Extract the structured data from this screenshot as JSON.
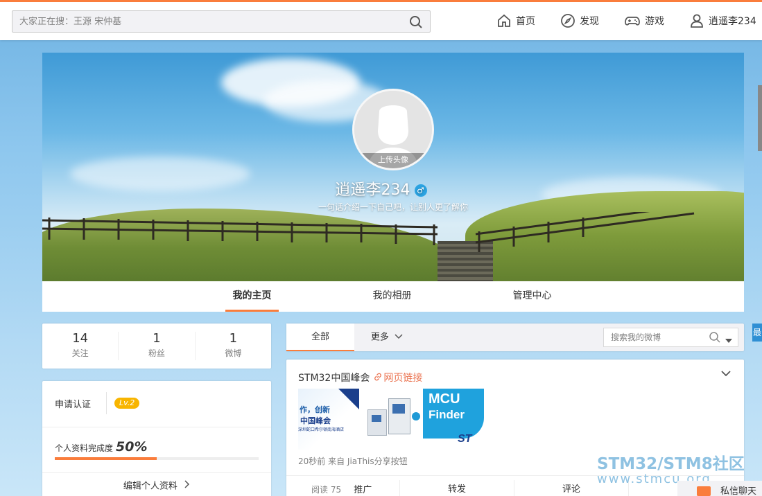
{
  "topbar": {
    "search_placeholder": "大家正在搜：王源 宋仲基",
    "nav": [
      {
        "label": "首页"
      },
      {
        "label": "发现"
      },
      {
        "label": "游戏"
      },
      {
        "label": "逍遥李234"
      }
    ]
  },
  "cover": {
    "upload_avatar": "上传头像",
    "username": "逍遥李234",
    "gender": "♂",
    "bio": "一句话介绍一下自己吧，让别人更了解你"
  },
  "tabs": [
    {
      "label": "我的主页",
      "active": true
    },
    {
      "label": "我的相册",
      "active": false
    },
    {
      "label": "管理中心",
      "active": false
    }
  ],
  "counts": [
    {
      "num": "14",
      "label": "关注"
    },
    {
      "num": "1",
      "label": "粉丝"
    },
    {
      "num": "1",
      "label": "微博"
    }
  ],
  "profile": {
    "verify_label": "申请认证",
    "level": "Lv.2",
    "complete_label": "个人资料完成度",
    "complete_value": "50%",
    "complete_fraction": 0.5,
    "edit_label": "编辑个人资料"
  },
  "feed": {
    "tab_all": "全部",
    "tab_more": "更多",
    "search_placeholder": "搜索我的微博"
  },
  "post": {
    "author": "STM32中国峰会",
    "link_label": "网页链接",
    "thumb1_line1": "作，创新",
    "thumb1_line2": "中国峰会",
    "thumb1_line3": "深圳蛇口希尔顿南海酒店",
    "thumb3_line1": "MCU",
    "thumb3_line2": "Finder",
    "meta": "20秒前 来自 JiaThis分享按钮",
    "read_label": "阅读 75",
    "promote_label": "推广",
    "repost_label": "转发",
    "comment_label": "评论"
  },
  "edge": {
    "tag": "最"
  },
  "watermark": {
    "line1": "STM32/STM8社区",
    "line2": "www.stmcu.org"
  },
  "chat": {
    "label": "私信聊天"
  },
  "colors": {
    "accent": "#fa7d3c",
    "link": "#eb7350",
    "level_badge": "#f8b500",
    "gender_blue": "#2ba3e2"
  }
}
